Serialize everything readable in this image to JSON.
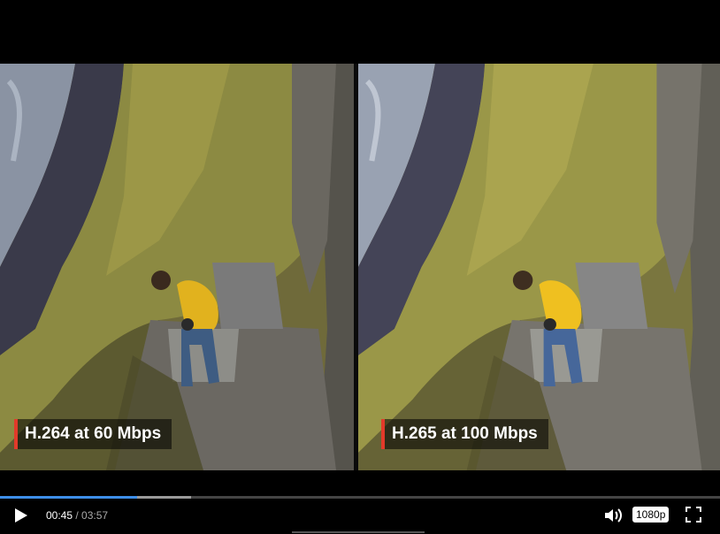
{
  "video": {
    "left_label": "H.264 at 60 Mbps",
    "right_label": "H.265 at 100 Mbps"
  },
  "player": {
    "current_time": "00:45",
    "separator": " / ",
    "total_time": "03:57",
    "played_fraction": 0.19,
    "buffered_fraction": 0.265,
    "quality": "1080p",
    "icons": [
      "play-icon",
      "volume-icon",
      "fullscreen-icon"
    ],
    "colors": {
      "progress": "#3d8ee8",
      "label_accent": "#e23a2a"
    }
  }
}
